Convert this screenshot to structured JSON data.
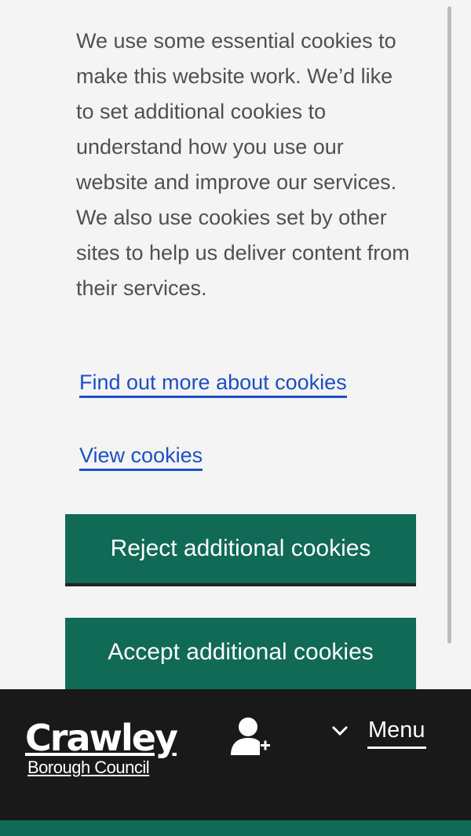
{
  "cookie_banner": {
    "message": "We use some essential cookies to make this website work. We’d like to set additional cookies to understand how you use our website and improve our services. We also use cookies set by other sites to help us deliver content from their services.",
    "find_out_more_link": "Find out more about cookies",
    "view_cookies_link": "View cookies",
    "reject_button": "Reject additional cookies",
    "accept_button": "Accept additional cookies"
  },
  "header": {
    "logo_title": "Crawley",
    "logo_subtitle": "Borough Council",
    "account_icon": "user-plus-icon",
    "menu_icon": "chevron-down-icon",
    "menu_label": "Menu"
  },
  "colors": {
    "accent_green": "#116a55",
    "link_blue": "#1d4fc4",
    "header_bg": "#191919",
    "panel_bg": "#f4f4f4",
    "body_text": "#505050"
  }
}
